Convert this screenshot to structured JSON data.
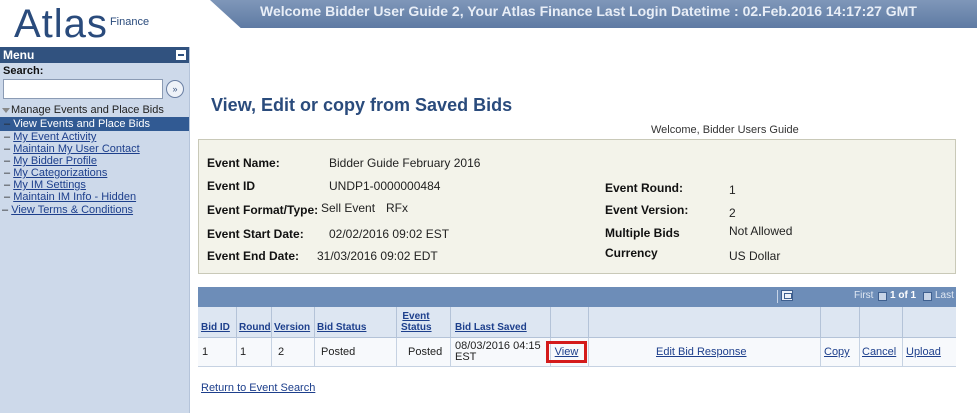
{
  "header": {
    "logo_main": "Atlas",
    "logo_sub": "Finance",
    "banner_text": "Welcome Bidder User Guide 2, Your Atlas Finance Last Login Datetime : 02.Feb.2016 14:17:27 GMT"
  },
  "menu": {
    "title": "Menu",
    "search_label": "Search:",
    "search_value": "",
    "search_go_icon": "double-chevron-right-icon",
    "parent_label": "Manage Events and Place Bids",
    "items": [
      {
        "label": "View Events and Place Bids",
        "active": true
      },
      {
        "label": "My Event Activity"
      },
      {
        "label": "Maintain My User Contact"
      },
      {
        "label": "My Bidder Profile"
      },
      {
        "label": "My Categorizations"
      },
      {
        "label": "My IM Settings"
      },
      {
        "label": "Maintain IM Info - Hidden"
      }
    ],
    "terms_label": "View Terms & Conditions"
  },
  "page": {
    "title": "View, Edit or copy from Saved Bids",
    "welcome": "Welcome, Bidder Users Guide"
  },
  "event": {
    "name_label": "Event Name:",
    "name_value": "Bidder Guide February 2016",
    "id_label": "Event ID",
    "id_value": "UNDP1-0000000484",
    "format_label": "Event Format/Type:",
    "format_value": "Sell Event",
    "type_value": "RFx",
    "start_label": "Event Start Date:",
    "start_value": "02/02/2016 09:02 EST",
    "end_label": "Event End Date:",
    "end_value": "31/03/2016 09:02 EDT",
    "round_label": "Event Round:",
    "round_value": "1",
    "version_label": "Event Version:",
    "version_value": "2",
    "multiple_label": "Multiple Bids",
    "multiple_value": "Not Allowed",
    "currency_label": "Currency",
    "currency_value": "US Dollar"
  },
  "grid": {
    "nav": {
      "first": "First",
      "page_info": "1 of 1",
      "last": "Last"
    },
    "headers": {
      "bid_id": "Bid ID",
      "round": "Round",
      "version": "Version",
      "bid_status": "Bid Status",
      "event_status": "Event Status",
      "bid_last_saved": "Bid Last Saved"
    },
    "row": {
      "bid_id": "1",
      "round": "1",
      "version": "2",
      "bid_status": "Posted",
      "event_status": "Posted",
      "bid_last_saved": "08/03/2016 04:15 EST",
      "view": "View",
      "edit": "Edit Bid Response",
      "copy": "Copy",
      "cancel": "Cancel",
      "upload": "Upload"
    }
  },
  "return_link": "Return to Event Search",
  "colors": {
    "brand": "#2a4b7c",
    "menu_bg": "#cdd9ea",
    "grid_nav": "#6d8db8",
    "highlight": "#d41b1b"
  }
}
